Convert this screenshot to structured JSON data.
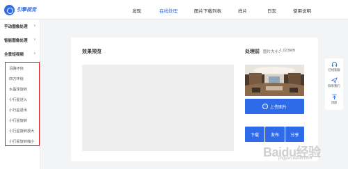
{
  "brand": {
    "name": "引擎视觉"
  },
  "nav": [
    {
      "label": "发现"
    },
    {
      "label": "在线处理"
    },
    {
      "label": "图片下载列表"
    },
    {
      "label": "样片"
    },
    {
      "label": "日志"
    },
    {
      "label": "使用说明"
    }
  ],
  "sidebar": {
    "groups": [
      {
        "label": "手动图像处理"
      },
      {
        "label": "智能图像处理"
      },
      {
        "label": "全景短视频"
      }
    ],
    "sub_items": [
      {
        "label": "沿路环绕"
      },
      {
        "label": "四方环绕"
      },
      {
        "label": "水晶球旋转"
      },
      {
        "label": "小行星进入"
      },
      {
        "label": "小行星退出"
      },
      {
        "label": "小行星旋转"
      },
      {
        "label": "小行星旋转放大"
      },
      {
        "label": "小行星旋转缩小"
      }
    ]
  },
  "panel": {
    "preview_title": "效果预览",
    "before_title": "处理前",
    "size_label": "图片大小：",
    "size_value": "1.023MB",
    "upload_label": "上传图片",
    "buttons": [
      {
        "label": "下载"
      },
      {
        "label": "发布"
      },
      {
        "label": "分享"
      }
    ]
  },
  "floatbar": {
    "items": [
      {
        "label": "在线客服",
        "icon": "headset-icon"
      },
      {
        "label": "联系我们",
        "icon": "send-icon"
      },
      {
        "label": "顶部",
        "icon": "arrow-up-icon"
      }
    ]
  },
  "watermark": {
    "logo": "Baidu经验",
    "sub": "jingyan.baidu.com"
  },
  "colors": {
    "accent": "#2f6be8",
    "highlight": "#e02020"
  }
}
